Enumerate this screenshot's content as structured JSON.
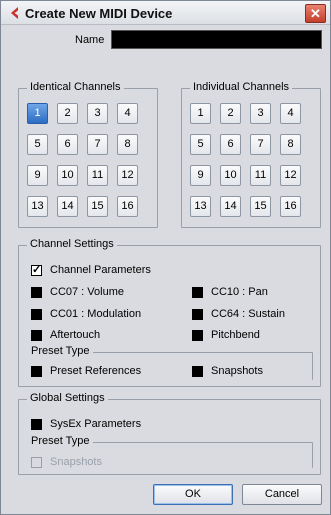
{
  "window": {
    "title": "Create New MIDI Device",
    "close_glyph": "✕",
    "icon": "cubase-logo-icon"
  },
  "name_field": {
    "label": "Name",
    "value": ""
  },
  "identical_channels": {
    "title": "Identical Channels",
    "selected": "1",
    "channels": [
      "1",
      "2",
      "3",
      "4",
      "5",
      "6",
      "7",
      "8",
      "9",
      "10",
      "11",
      "12",
      "13",
      "14",
      "15",
      "16"
    ]
  },
  "individual_channels": {
    "title": "Individual Channels",
    "channels": [
      "1",
      "2",
      "3",
      "4",
      "5",
      "6",
      "7",
      "8",
      "9",
      "10",
      "11",
      "12",
      "13",
      "14",
      "15",
      "16"
    ]
  },
  "channel_settings": {
    "title": "Channel Settings",
    "channel_parameters": {
      "label": "Channel Parameters",
      "checked": true
    },
    "cc07": {
      "label": "CC07 : Volume",
      "checked": false
    },
    "cc10": {
      "label": "CC10 : Pan",
      "checked": false
    },
    "cc01": {
      "label": "CC01 : Modulation",
      "checked": false
    },
    "cc64": {
      "label": "CC64 : Sustain",
      "checked": false
    },
    "aftertouch": {
      "label": "Aftertouch",
      "checked": false
    },
    "pitchbend": {
      "label": "Pitchbend",
      "checked": false
    },
    "preset_type": {
      "title": "Preset Type",
      "preset_references": {
        "label": "Preset References",
        "checked": false
      },
      "snapshots": {
        "label": "Snapshots",
        "checked": false
      }
    }
  },
  "global_settings": {
    "title": "Global Settings",
    "sysex": {
      "label": "SysEx Parameters",
      "checked": false
    },
    "preset_type": {
      "title": "Preset Type",
      "snapshots": {
        "label": "Snapshots",
        "checked": false,
        "disabled": true
      }
    }
  },
  "buttons": {
    "ok": "OK",
    "cancel": "Cancel"
  },
  "colors": {
    "selected_channel": "#2d6cc4",
    "dialog_bg": "#d9dbe0",
    "close_button": "#c43f2c"
  }
}
